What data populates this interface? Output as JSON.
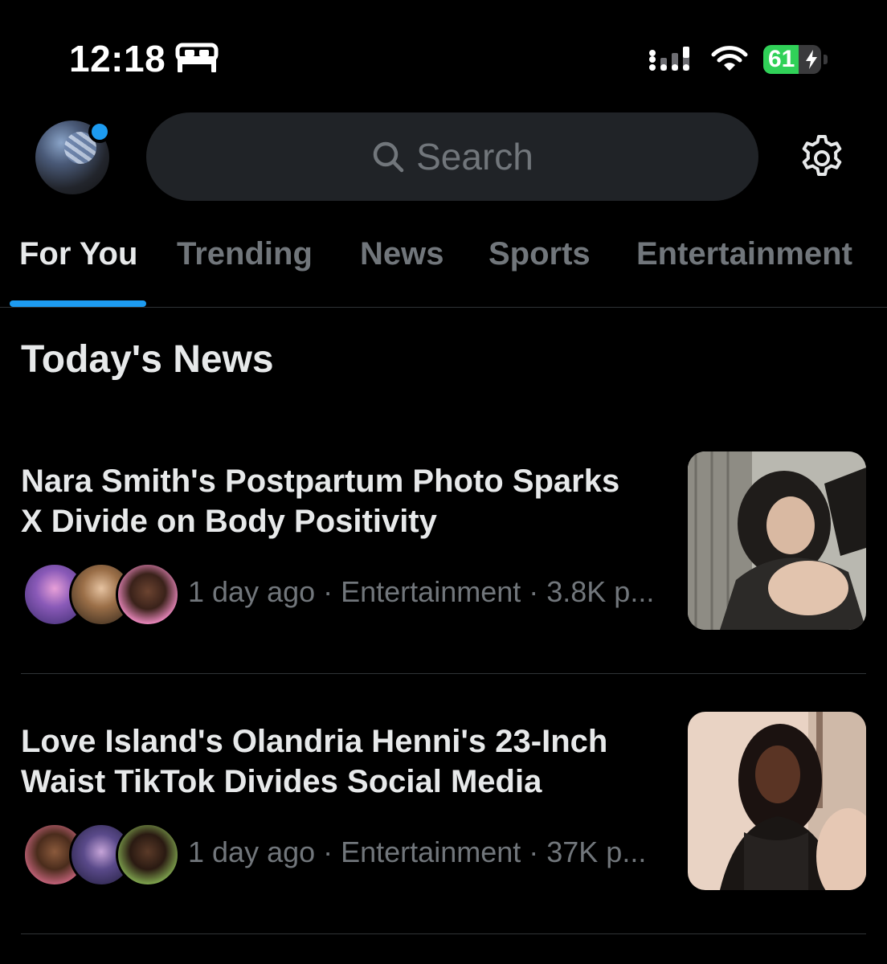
{
  "status_bar": {
    "time": "12:18",
    "battery_percent": "61",
    "battery_level": 0.61,
    "icons": [
      "bed-icon",
      "cellular-signal-icon",
      "wifi-icon",
      "battery-charging-icon"
    ]
  },
  "header": {
    "search_placeholder": "Search",
    "notification_dot_color": "#1d9bf0",
    "icons": [
      "avatar",
      "search-icon",
      "gear-icon"
    ]
  },
  "tabs": [
    {
      "label": "For You",
      "active": true
    },
    {
      "label": "Trending",
      "active": false
    },
    {
      "label": "News",
      "active": false
    },
    {
      "label": "Sports",
      "active": false
    },
    {
      "label": "Entertainment",
      "active": false
    }
  ],
  "section": {
    "title": "Today's News"
  },
  "stories": [
    {
      "headline_line1": "Nara Smith's Postpartum Photo Sparks",
      "headline_line2": "X Divide on Body Positivity",
      "meta": "1 day ago · Entertainment · 3.8K p..."
    },
    {
      "headline_line1": "Love Island's Olandria Henni's 23-Inch",
      "headline_line2": "Waist TikTok Divides Social Media",
      "meta": "1 day ago · Entertainment · 37K p..."
    }
  ],
  "colors": {
    "background": "#000000",
    "accent": "#1d9bf0",
    "primary_text": "#e7e9ea",
    "secondary_text": "#71767b",
    "search_bg": "#202327",
    "battery_green": "#30d158"
  }
}
